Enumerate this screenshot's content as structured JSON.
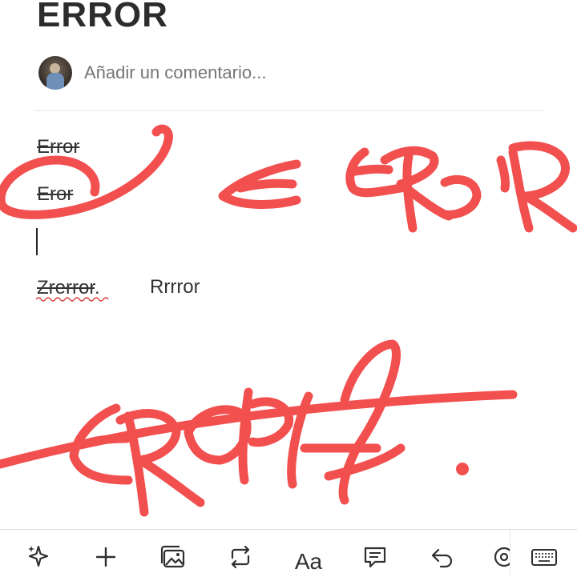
{
  "page": {
    "title": "ERROR"
  },
  "comment": {
    "placeholder": "Añadir un comentario..."
  },
  "content": {
    "line1": "Error",
    "line2": "Eror",
    "line3_part1": "Zrerror",
    "line3_dot": ".",
    "line3_part2": "Rrrror"
  },
  "ink_color": "#f24f4f",
  "toolbar": {
    "items": [
      {
        "icon": "sparkle-icon"
      },
      {
        "icon": "plus-icon"
      },
      {
        "icon": "image-gallery-icon"
      },
      {
        "icon": "convert-icon"
      },
      {
        "icon": "text-format-icon",
        "label": "Aa"
      },
      {
        "icon": "comment-icon"
      },
      {
        "icon": "undo-icon"
      },
      {
        "icon": "mention-icon"
      },
      {
        "icon": "keyboard-icon"
      }
    ]
  }
}
